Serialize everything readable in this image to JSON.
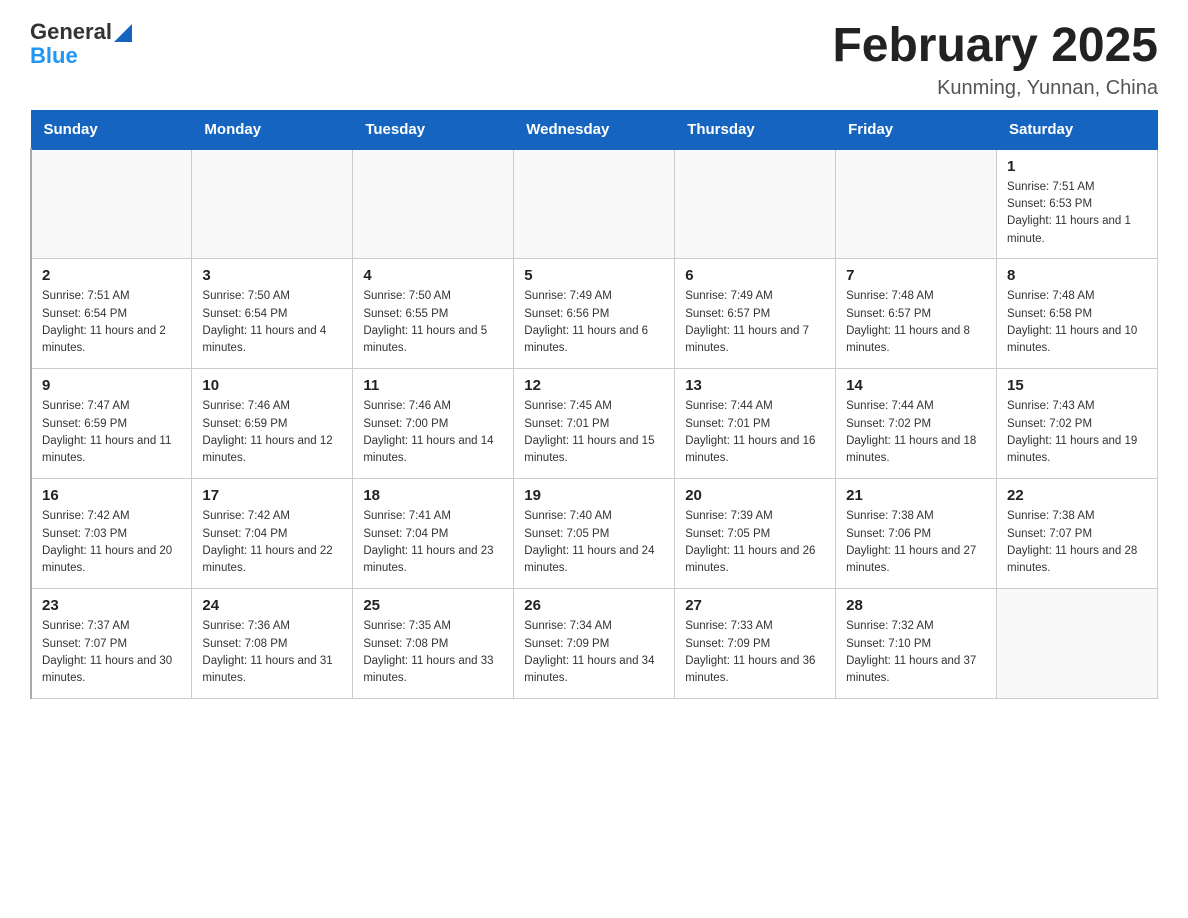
{
  "header": {
    "logo_general": "General",
    "logo_blue": "Blue",
    "title": "February 2025",
    "subtitle": "Kunming, Yunnan, China"
  },
  "days_of_week": [
    "Sunday",
    "Monday",
    "Tuesday",
    "Wednesday",
    "Thursday",
    "Friday",
    "Saturday"
  ],
  "weeks": [
    [
      {
        "day": "",
        "sunrise": "",
        "sunset": "",
        "daylight": ""
      },
      {
        "day": "",
        "sunrise": "",
        "sunset": "",
        "daylight": ""
      },
      {
        "day": "",
        "sunrise": "",
        "sunset": "",
        "daylight": ""
      },
      {
        "day": "",
        "sunrise": "",
        "sunset": "",
        "daylight": ""
      },
      {
        "day": "",
        "sunrise": "",
        "sunset": "",
        "daylight": ""
      },
      {
        "day": "",
        "sunrise": "",
        "sunset": "",
        "daylight": ""
      },
      {
        "day": "1",
        "sunrise": "Sunrise: 7:51 AM",
        "sunset": "Sunset: 6:53 PM",
        "daylight": "Daylight: 11 hours and 1 minute."
      }
    ],
    [
      {
        "day": "2",
        "sunrise": "Sunrise: 7:51 AM",
        "sunset": "Sunset: 6:54 PM",
        "daylight": "Daylight: 11 hours and 2 minutes."
      },
      {
        "day": "3",
        "sunrise": "Sunrise: 7:50 AM",
        "sunset": "Sunset: 6:54 PM",
        "daylight": "Daylight: 11 hours and 4 minutes."
      },
      {
        "day": "4",
        "sunrise": "Sunrise: 7:50 AM",
        "sunset": "Sunset: 6:55 PM",
        "daylight": "Daylight: 11 hours and 5 minutes."
      },
      {
        "day": "5",
        "sunrise": "Sunrise: 7:49 AM",
        "sunset": "Sunset: 6:56 PM",
        "daylight": "Daylight: 11 hours and 6 minutes."
      },
      {
        "day": "6",
        "sunrise": "Sunrise: 7:49 AM",
        "sunset": "Sunset: 6:57 PM",
        "daylight": "Daylight: 11 hours and 7 minutes."
      },
      {
        "day": "7",
        "sunrise": "Sunrise: 7:48 AM",
        "sunset": "Sunset: 6:57 PM",
        "daylight": "Daylight: 11 hours and 8 minutes."
      },
      {
        "day": "8",
        "sunrise": "Sunrise: 7:48 AM",
        "sunset": "Sunset: 6:58 PM",
        "daylight": "Daylight: 11 hours and 10 minutes."
      }
    ],
    [
      {
        "day": "9",
        "sunrise": "Sunrise: 7:47 AM",
        "sunset": "Sunset: 6:59 PM",
        "daylight": "Daylight: 11 hours and 11 minutes."
      },
      {
        "day": "10",
        "sunrise": "Sunrise: 7:46 AM",
        "sunset": "Sunset: 6:59 PM",
        "daylight": "Daylight: 11 hours and 12 minutes."
      },
      {
        "day": "11",
        "sunrise": "Sunrise: 7:46 AM",
        "sunset": "Sunset: 7:00 PM",
        "daylight": "Daylight: 11 hours and 14 minutes."
      },
      {
        "day": "12",
        "sunrise": "Sunrise: 7:45 AM",
        "sunset": "Sunset: 7:01 PM",
        "daylight": "Daylight: 11 hours and 15 minutes."
      },
      {
        "day": "13",
        "sunrise": "Sunrise: 7:44 AM",
        "sunset": "Sunset: 7:01 PM",
        "daylight": "Daylight: 11 hours and 16 minutes."
      },
      {
        "day": "14",
        "sunrise": "Sunrise: 7:44 AM",
        "sunset": "Sunset: 7:02 PM",
        "daylight": "Daylight: 11 hours and 18 minutes."
      },
      {
        "day": "15",
        "sunrise": "Sunrise: 7:43 AM",
        "sunset": "Sunset: 7:02 PM",
        "daylight": "Daylight: 11 hours and 19 minutes."
      }
    ],
    [
      {
        "day": "16",
        "sunrise": "Sunrise: 7:42 AM",
        "sunset": "Sunset: 7:03 PM",
        "daylight": "Daylight: 11 hours and 20 minutes."
      },
      {
        "day": "17",
        "sunrise": "Sunrise: 7:42 AM",
        "sunset": "Sunset: 7:04 PM",
        "daylight": "Daylight: 11 hours and 22 minutes."
      },
      {
        "day": "18",
        "sunrise": "Sunrise: 7:41 AM",
        "sunset": "Sunset: 7:04 PM",
        "daylight": "Daylight: 11 hours and 23 minutes."
      },
      {
        "day": "19",
        "sunrise": "Sunrise: 7:40 AM",
        "sunset": "Sunset: 7:05 PM",
        "daylight": "Daylight: 11 hours and 24 minutes."
      },
      {
        "day": "20",
        "sunrise": "Sunrise: 7:39 AM",
        "sunset": "Sunset: 7:05 PM",
        "daylight": "Daylight: 11 hours and 26 minutes."
      },
      {
        "day": "21",
        "sunrise": "Sunrise: 7:38 AM",
        "sunset": "Sunset: 7:06 PM",
        "daylight": "Daylight: 11 hours and 27 minutes."
      },
      {
        "day": "22",
        "sunrise": "Sunrise: 7:38 AM",
        "sunset": "Sunset: 7:07 PM",
        "daylight": "Daylight: 11 hours and 28 minutes."
      }
    ],
    [
      {
        "day": "23",
        "sunrise": "Sunrise: 7:37 AM",
        "sunset": "Sunset: 7:07 PM",
        "daylight": "Daylight: 11 hours and 30 minutes."
      },
      {
        "day": "24",
        "sunrise": "Sunrise: 7:36 AM",
        "sunset": "Sunset: 7:08 PM",
        "daylight": "Daylight: 11 hours and 31 minutes."
      },
      {
        "day": "25",
        "sunrise": "Sunrise: 7:35 AM",
        "sunset": "Sunset: 7:08 PM",
        "daylight": "Daylight: 11 hours and 33 minutes."
      },
      {
        "day": "26",
        "sunrise": "Sunrise: 7:34 AM",
        "sunset": "Sunset: 7:09 PM",
        "daylight": "Daylight: 11 hours and 34 minutes."
      },
      {
        "day": "27",
        "sunrise": "Sunrise: 7:33 AM",
        "sunset": "Sunset: 7:09 PM",
        "daylight": "Daylight: 11 hours and 36 minutes."
      },
      {
        "day": "28",
        "sunrise": "Sunrise: 7:32 AM",
        "sunset": "Sunset: 7:10 PM",
        "daylight": "Daylight: 11 hours and 37 minutes."
      },
      {
        "day": "",
        "sunrise": "",
        "sunset": "",
        "daylight": ""
      }
    ]
  ]
}
